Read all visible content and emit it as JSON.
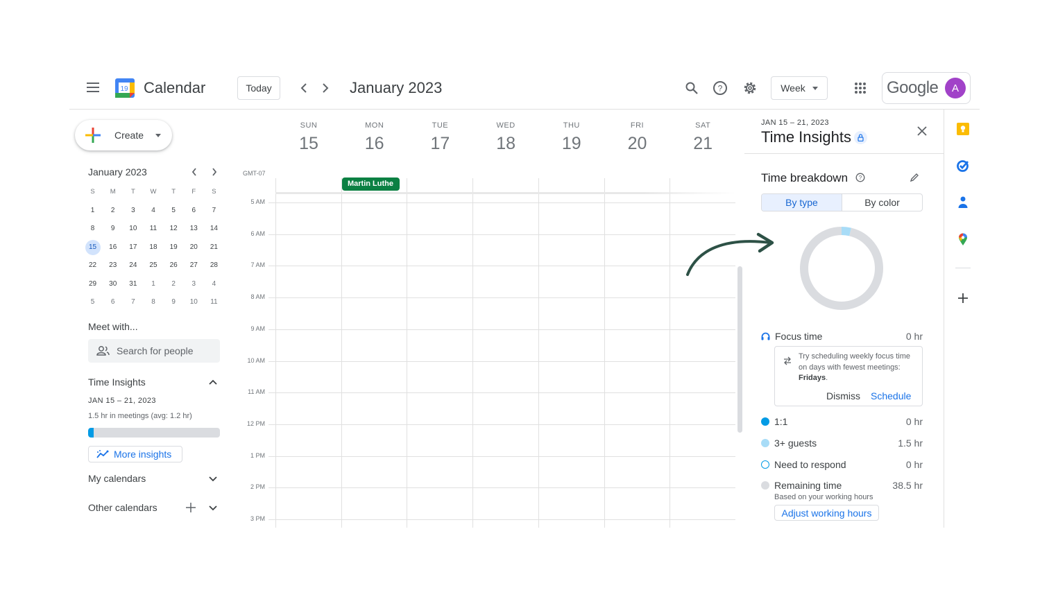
{
  "header": {
    "menu_icon": "hamburger-icon",
    "logo_day": "19",
    "app_title": "Calendar",
    "today_label": "Today",
    "prev_icon": "chevron-left-icon",
    "next_icon": "chevron-right-icon",
    "current_period": "January 2023",
    "view_selector": "Week",
    "brand": "Google",
    "avatar_initial": "A"
  },
  "sidebar": {
    "create_label": "Create",
    "mini_calendar": {
      "title": "January 2023",
      "weekdays": [
        "S",
        "M",
        "T",
        "W",
        "T",
        "F",
        "S"
      ],
      "weeks": [
        [
          "1",
          "2",
          "3",
          "4",
          "5",
          "6",
          "7"
        ],
        [
          "8",
          "9",
          "10",
          "11",
          "12",
          "13",
          "14"
        ],
        [
          "15",
          "16",
          "17",
          "18",
          "19",
          "20",
          "21"
        ],
        [
          "22",
          "23",
          "24",
          "25",
          "26",
          "27",
          "28"
        ],
        [
          "29",
          "30",
          "31",
          "1",
          "2",
          "3",
          "4"
        ],
        [
          "5",
          "6",
          "7",
          "8",
          "9",
          "10",
          "11"
        ]
      ],
      "selected": "15"
    },
    "meet_with_label": "Meet with...",
    "search_people_placeholder": "Search for people",
    "time_insights": {
      "label": "Time Insights",
      "date_range": "JAN 15 – 21, 2023",
      "meetings_summary": "1.5 hr in meetings (avg: 1.2 hr)",
      "meeting_fraction": 0.04,
      "more_insights_label": "More insights"
    },
    "my_calendars_label": "My calendars",
    "other_calendars_label": "Other calendars"
  },
  "week": {
    "timezone": "GMT-07",
    "days": [
      {
        "name": "SUN",
        "num": "15"
      },
      {
        "name": "MON",
        "num": "16"
      },
      {
        "name": "TUE",
        "num": "17"
      },
      {
        "name": "WED",
        "num": "18"
      },
      {
        "name": "THU",
        "num": "19"
      },
      {
        "name": "FRI",
        "num": "20"
      },
      {
        "name": "SAT",
        "num": "21"
      }
    ],
    "hours": [
      "5 AM",
      "6 AM",
      "7 AM",
      "8 AM",
      "9 AM",
      "10 AM",
      "11 AM",
      "12 PM",
      "1 PM",
      "2 PM",
      "3 PM"
    ],
    "events": [
      {
        "title": "Martin Luthe",
        "day": "MON",
        "all_day": true,
        "color": "#0b8043"
      }
    ]
  },
  "insights_panel": {
    "date_range": "JAN 15 – 21, 2023",
    "title": "Time Insights",
    "breakdown_title": "Time breakdown",
    "tabs": [
      {
        "label": "By type",
        "active": true
      },
      {
        "label": "By color",
        "active": false
      }
    ],
    "donut": {
      "segments": [
        {
          "name": "1:1",
          "hours": 0,
          "color": "#039be5"
        },
        {
          "name": "3+ guests",
          "hours": 1.5,
          "color": "#a8dcf7"
        },
        {
          "name": "Need to respond",
          "hours": 0,
          "color": "#039be5"
        },
        {
          "name": "Remaining time",
          "hours": 38.5,
          "color": "#dadce0"
        }
      ]
    },
    "focus": {
      "label": "Focus time",
      "value": "0 hr",
      "tip_prefix": "Try scheduling weekly focus time on days with fewest meetings: ",
      "tip_bold": "Fridays",
      "tip_suffix": ".",
      "dismiss_label": "Dismiss",
      "schedule_label": "Schedule"
    },
    "legend": [
      {
        "label": "1:1",
        "value": "0 hr",
        "color": "#039be5",
        "style": "filled"
      },
      {
        "label": "3+ guests",
        "value": "1.5 hr",
        "color": "#a8dcf7",
        "style": "filled"
      },
      {
        "label": "Need to respond",
        "value": "0 hr",
        "color": "#039be5",
        "style": "outline"
      },
      {
        "label": "Remaining time",
        "value": "38.5 hr",
        "color": "#dadce0",
        "style": "filled"
      }
    ],
    "remaining_note": "Based on your working hours",
    "adjust_label": "Adjust working hours"
  },
  "right_rail": {
    "apps": [
      "keep-icon",
      "tasks-icon",
      "contacts-icon",
      "maps-icon"
    ],
    "add_icon": "plus-icon"
  }
}
